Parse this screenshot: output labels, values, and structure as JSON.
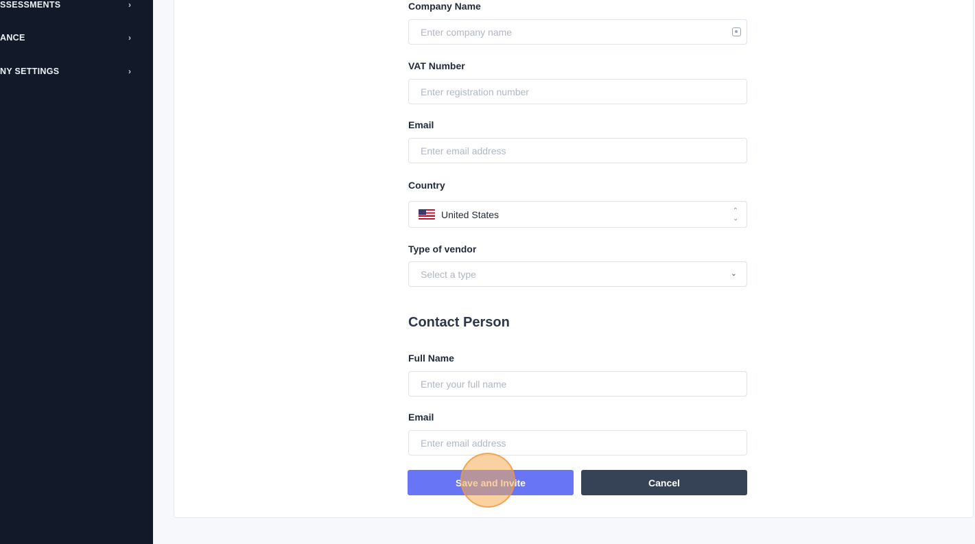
{
  "sidebar": {
    "items": [
      {
        "label": "SSESSMENTS",
        "chevron": "›"
      },
      {
        "label": "ANCE",
        "chevron": "›"
      },
      {
        "label": "NY SETTINGS",
        "chevron": "›"
      }
    ]
  },
  "form": {
    "company_name": {
      "label": "Company Name",
      "placeholder": "Enter company name"
    },
    "vat_number": {
      "label": "VAT Number",
      "placeholder": "Enter registration number"
    },
    "email": {
      "label": "Email",
      "placeholder": "Enter email address"
    },
    "country": {
      "label": "Country",
      "value": "United States"
    },
    "vendor_type": {
      "label": "Type of vendor",
      "placeholder": "Select a type"
    }
  },
  "contact": {
    "title": "Contact Person",
    "full_name": {
      "label": "Full Name",
      "placeholder": "Enter your full name"
    },
    "email": {
      "label": "Email",
      "placeholder": "Enter email address"
    }
  },
  "buttons": {
    "save_invite": "Save and Invite",
    "cancel": "Cancel"
  },
  "colors": {
    "sidebar_bg": "#121a2a",
    "primary": "#6875f5",
    "secondary": "#364357",
    "click_highlight": "#f6ad55"
  },
  "icons": {
    "company_field": "contact-card-icon",
    "country_select": "up-down-chevron-icon",
    "vendor_select": "chevron-down-icon",
    "sidebar": "chevron-right-icon"
  }
}
